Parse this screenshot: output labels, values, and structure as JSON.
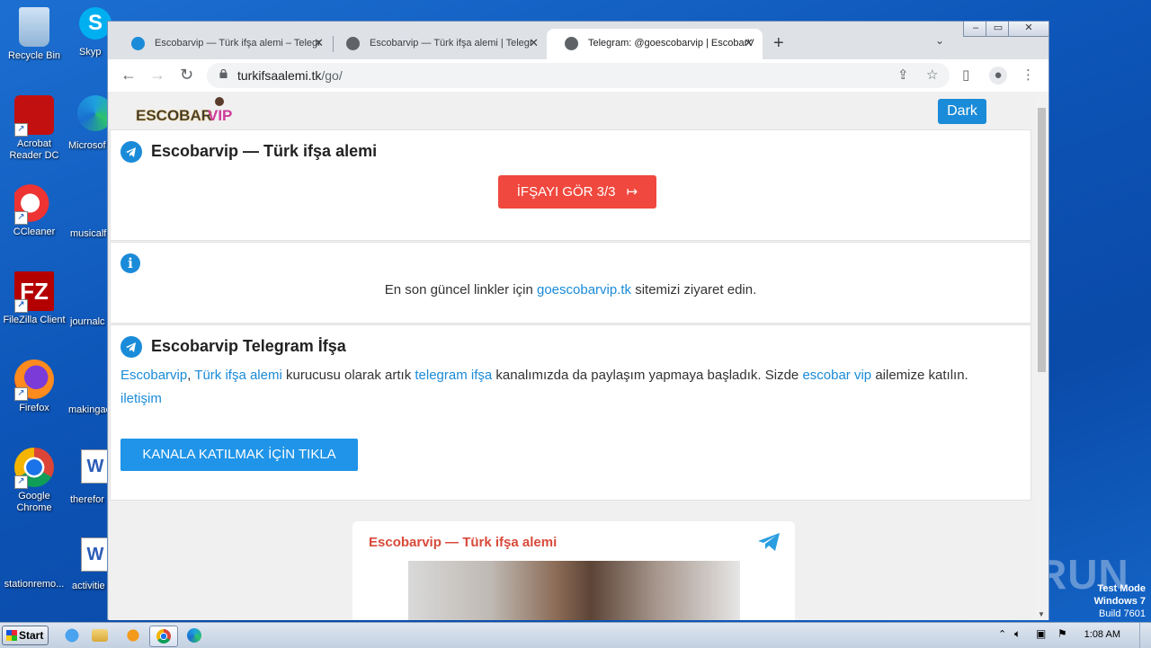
{
  "desktop": {
    "icons": [
      {
        "label": "Recycle Bin"
      },
      {
        "label": "Acrobat Reader DC"
      },
      {
        "label": "CCleaner"
      },
      {
        "label": "FileZilla Client"
      },
      {
        "label": "Firefox"
      },
      {
        "label": "Google Chrome"
      },
      {
        "label": "stationremo..."
      }
    ],
    "icons_col2": [
      {
        "label": "Skyp"
      },
      {
        "label": "Microsof"
      },
      {
        "label": "musicalf"
      },
      {
        "label": "journalc"
      },
      {
        "label": "makingac"
      },
      {
        "label": "therefor"
      },
      {
        "label": "activitie"
      }
    ],
    "watermark": "ANY RUN",
    "test_mode": {
      "line1": "Test Mode",
      "line2": "Windows 7",
      "line3": "Build 7601"
    }
  },
  "browser": {
    "tabs": [
      {
        "title": "Escobarvip — Türk ifşa alemi – Telegr",
        "icon": "telegram-icon"
      },
      {
        "title": "Escobarvip — Türk ifşa alemi | Telegr",
        "icon": "globe-icon"
      },
      {
        "title": "Telegram: @goescobarvip | EscobarV",
        "icon": "globe-icon"
      }
    ],
    "url_host": "turkifsaalemi.tk",
    "url_path": "/go/"
  },
  "page": {
    "logo_text": "ESCOBARVIP",
    "dark_button": "Dark",
    "card1": {
      "title": "Escobarvip — Türk ifşa alemi",
      "button": "İFŞAYI GÖR 3/3"
    },
    "card2": {
      "text_before": "En son güncel linkler için ",
      "link": "goescobarvip.tk",
      "text_after": " sitemizi ziyaret edin."
    },
    "card3": {
      "title": "Escobarvip Telegram İfşa",
      "link1": "Escobarvip",
      "sep1": ", ",
      "link2": "Türk ifşa alemi",
      "text1": " kurucusu olarak artık ",
      "link3": "telegram ifşa",
      "text2": " kanalımızda da paylaşım yapmaya başladık. Sizde ",
      "link4": "escobar vip",
      "text3": " ailemize katılın.",
      "link5": "iletişim",
      "button": "KANALA KATILMAK İÇİN TIKLA"
    },
    "preview": {
      "title": "Escobarvip — Türk ifşa alemi"
    }
  },
  "taskbar": {
    "start": "Start",
    "clock": "1:08 AM"
  },
  "colors": {
    "accent": "#1a8bd8",
    "red_button": "#f0483e",
    "preview_title": "#d84a3a"
  }
}
